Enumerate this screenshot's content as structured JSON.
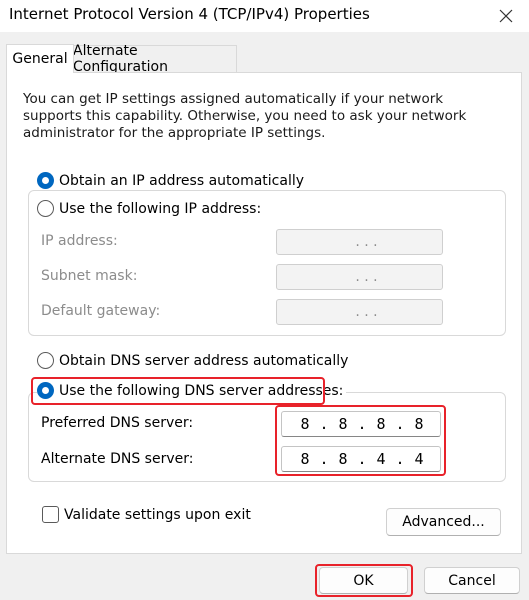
{
  "window": {
    "title": "Internet Protocol Version 4 (TCP/IPv4) Properties",
    "close_icon": "close-icon"
  },
  "tabs": [
    {
      "label": "General",
      "selected": true
    },
    {
      "label": "Alternate Configuration",
      "selected": false
    }
  ],
  "description": "You can get IP settings assigned automatically if your network supports this capability. Otherwise, you need to ask your network administrator for the appropriate IP settings.",
  "ip_section": {
    "auto_radio": {
      "label": "Obtain an IP address automatically",
      "checked": true
    },
    "manual_radio": {
      "label": "Use the following IP address:",
      "checked": false
    },
    "fields": [
      {
        "label": "IP address:",
        "value": ". . ."
      },
      {
        "label": "Subnet mask:",
        "value": ". . ."
      },
      {
        "label": "Default gateway:",
        "value": ". . ."
      }
    ]
  },
  "dns_section": {
    "auto_radio": {
      "label": "Obtain DNS server address automatically",
      "checked": false
    },
    "manual_radio": {
      "label": "Use the following DNS server addresses:",
      "checked": true
    },
    "preferred": {
      "label": "Preferred DNS server:",
      "octets": [
        "8",
        "8",
        "8",
        "8"
      ]
    },
    "alternate": {
      "label": "Alternate DNS server:",
      "octets": [
        "8",
        "8",
        "4",
        "4"
      ]
    }
  },
  "validate_checkbox": {
    "label": "Validate settings upon exit",
    "checked": false
  },
  "buttons": {
    "advanced": "Advanced...",
    "ok": "OK",
    "cancel": "Cancel"
  },
  "colors": {
    "accent": "#0067c0",
    "highlight": "#e8222a"
  }
}
